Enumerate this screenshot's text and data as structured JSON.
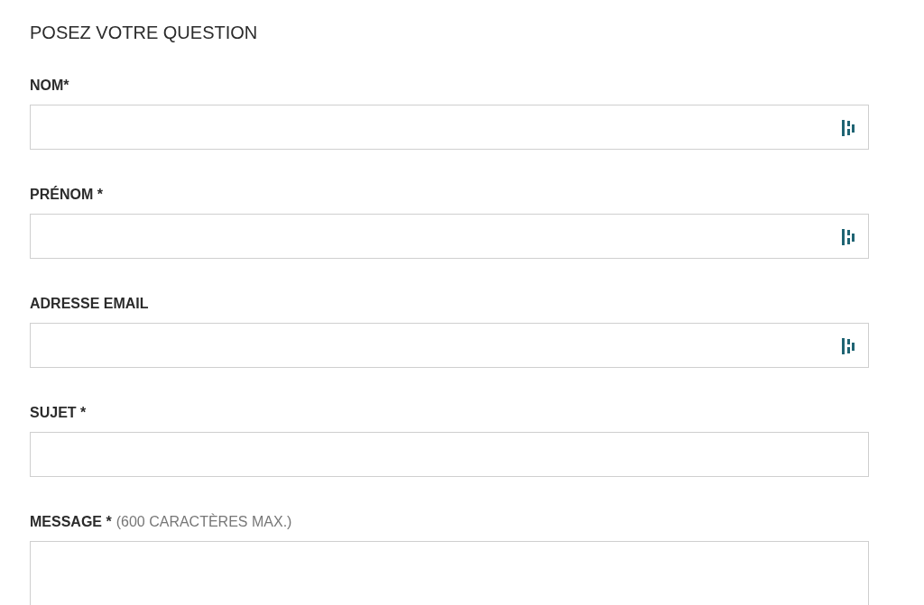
{
  "title": "POSEZ VOTRE QUESTION",
  "fields": [
    {
      "label": "NOM*",
      "kind": "input",
      "autofill_icon": true
    },
    {
      "label": "PRÉNOM *",
      "kind": "input",
      "autofill_icon": true
    },
    {
      "label": "ADRESSE EMAIL",
      "kind": "input",
      "autofill_icon": true
    },
    {
      "label": "SUJET *",
      "kind": "input",
      "autofill_icon": false
    },
    {
      "label": "MESSAGE *",
      "hint": "(600 CARACTÈRES MAX.)",
      "kind": "textarea",
      "autofill_icon": false
    }
  ]
}
